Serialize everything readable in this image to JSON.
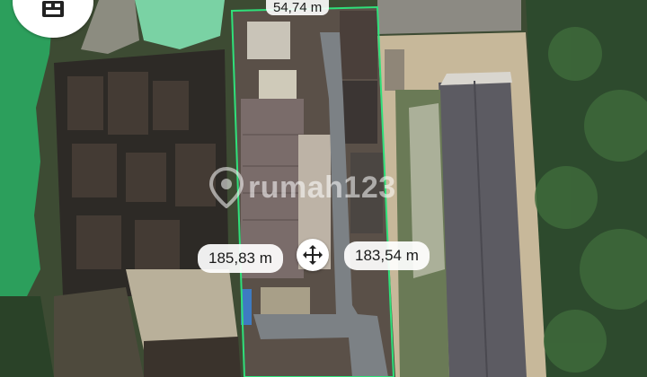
{
  "measurements": {
    "top_edge": "54,74 m",
    "left_edge": "185,83 m",
    "right_edge": "183,54 m"
  },
  "watermark": {
    "brand": "rumah123"
  },
  "colors": {
    "boundary": "#2fe07a",
    "pond_green": "#2fb36a",
    "roof_gray": "#5c5b62",
    "road": "#7c8185"
  },
  "icons": {
    "corner_button": "layers-icon",
    "center_button": "move-icon"
  }
}
